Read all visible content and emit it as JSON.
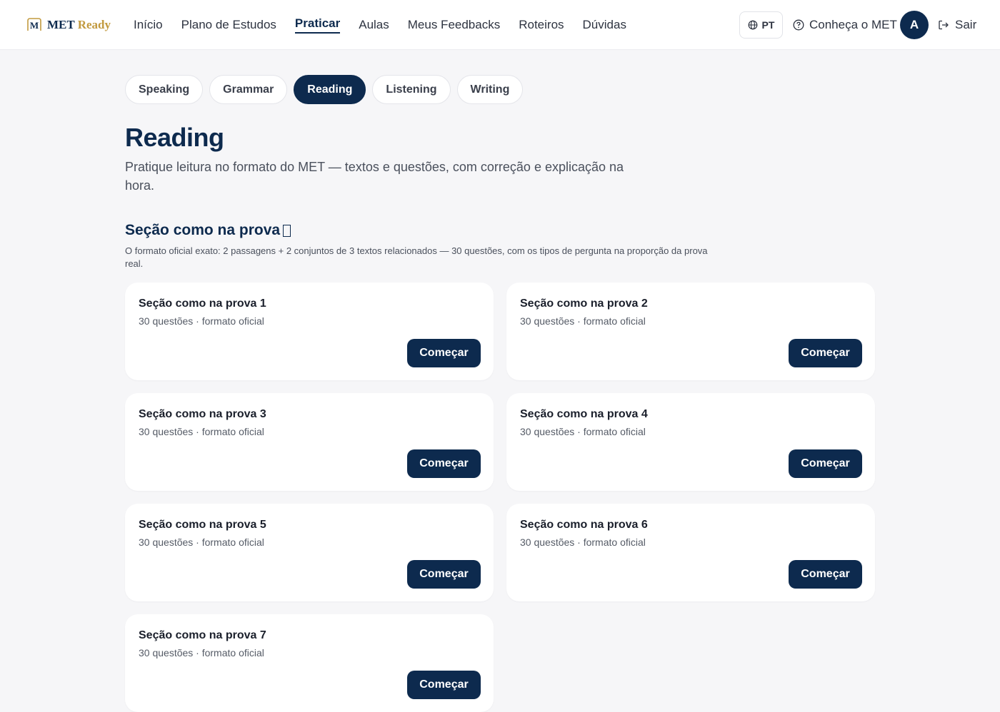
{
  "header": {
    "logo": {
      "mark": "M",
      "brand": "MET",
      "product": "Ready"
    },
    "nav": [
      {
        "label": "Início",
        "active": false
      },
      {
        "label": "Plano de Estudos",
        "active": false
      },
      {
        "label": "Praticar",
        "active": true
      },
      {
        "label": "Aulas",
        "active": false
      },
      {
        "label": "Meus Feedbacks",
        "active": false
      },
      {
        "label": "Roteiros",
        "active": false
      },
      {
        "label": "Dúvidas",
        "active": false
      }
    ],
    "language": {
      "label": "PT",
      "icon": "globe-icon"
    },
    "know_met": {
      "label": "Conheça o MET",
      "icon": "help-circle-icon"
    },
    "avatar": {
      "initial": "A"
    },
    "logout": {
      "label": "Sair",
      "icon": "logout-icon"
    }
  },
  "tabs": [
    {
      "label": "Speaking",
      "active": false
    },
    {
      "label": "Grammar",
      "active": false
    },
    {
      "label": "Reading",
      "active": true
    },
    {
      "label": "Listening",
      "active": false
    },
    {
      "label": "Writing",
      "active": false
    }
  ],
  "page": {
    "title": "Reading",
    "description": "Pratique leitura no formato do MET — textos e questões, com correção e explicação na hora."
  },
  "section": {
    "title": "Seção como na prova",
    "description": "O formato oficial exato: 2 passagens + 2 conjuntos de 3 textos relacionados — 30 questões, com os tipos de pergunta na proporção da prova real."
  },
  "cards": [
    {
      "title": "Seção como na prova 1",
      "subtitle": "30 questões · formato oficial",
      "button": "Começar"
    },
    {
      "title": "Seção como na prova 2",
      "subtitle": "30 questões · formato oficial",
      "button": "Começar"
    },
    {
      "title": "Seção como na prova 3",
      "subtitle": "30 questões · formato oficial",
      "button": "Começar"
    },
    {
      "title": "Seção como na prova 4",
      "subtitle": "30 questões · formato oficial",
      "button": "Começar"
    },
    {
      "title": "Seção como na prova 5",
      "subtitle": "30 questões · formato oficial",
      "button": "Começar"
    },
    {
      "title": "Seção como na prova 6",
      "subtitle": "30 questões · formato oficial",
      "button": "Começar"
    },
    {
      "title": "Seção como na prova 7",
      "subtitle": "30 questões · formato oficial",
      "button": "Começar"
    }
  ],
  "colors": {
    "primary": "#0d2a4e",
    "accent_gold": "#c29a3f",
    "background": "#f6f6f8"
  }
}
